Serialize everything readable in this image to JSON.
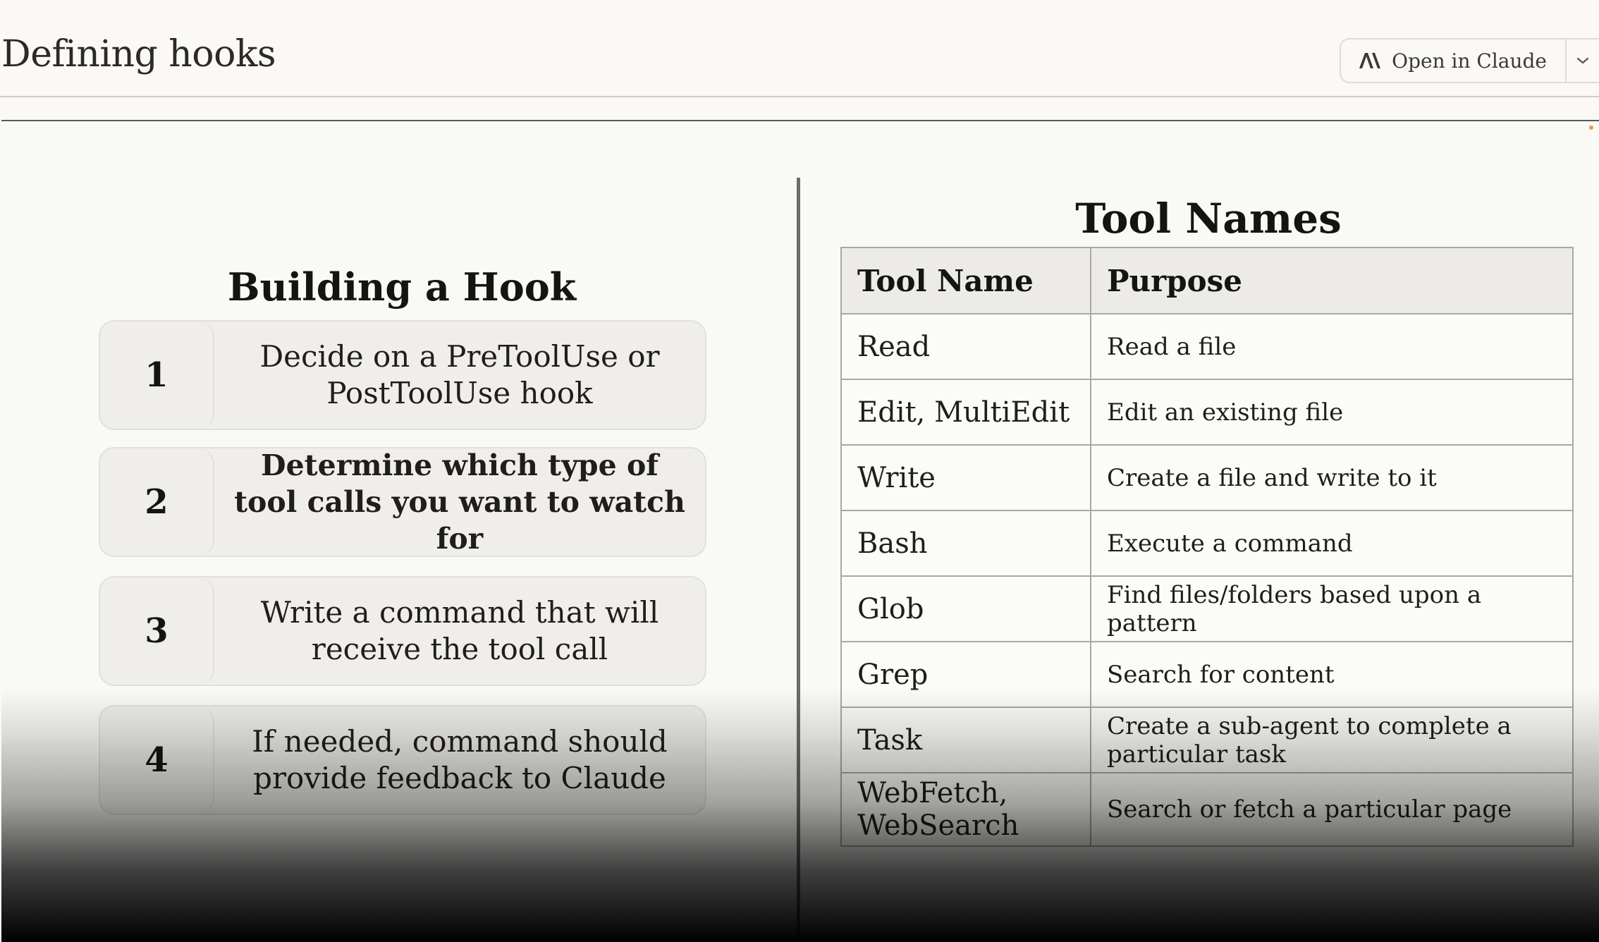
{
  "header": {
    "title": "Defining hooks",
    "open_button_label": "Open in Claude"
  },
  "slide": {
    "left": {
      "heading": "Building a Hook",
      "steps": [
        {
          "number": "1",
          "text": "Decide on a PreToolUse or PostToolUse hook",
          "emphasized": false
        },
        {
          "number": "2",
          "text": "Determine which type of tool calls you want to watch for",
          "emphasized": true
        },
        {
          "number": "3",
          "text": "Write a command that will receive the tool call",
          "emphasized": false
        },
        {
          "number": "4",
          "text": "If needed, command should provide feedback to Claude",
          "emphasized": false
        }
      ]
    },
    "right": {
      "heading": "Tool Names",
      "columns": [
        "Tool Name",
        "Purpose"
      ],
      "rows": [
        {
          "name": "Read",
          "purpose": "Read a file"
        },
        {
          "name": "Edit, MultiEdit",
          "purpose": "Edit an existing file"
        },
        {
          "name": "Write",
          "purpose": "Create a file and write to it"
        },
        {
          "name": "Bash",
          "purpose": "Execute a command"
        },
        {
          "name": "Glob",
          "purpose": "Find files/folders based upon a pattern"
        },
        {
          "name": "Grep",
          "purpose": "Search for content"
        },
        {
          "name": "Task",
          "purpose": "Create a sub-agent to complete a particular task"
        },
        {
          "name": "WebFetch, WebSearch",
          "purpose": "Search or fetch a particular page"
        }
      ]
    }
  },
  "icons": {
    "open_button_icon": "anthropic-logo-icon",
    "dropdown_icon": "chevron-down-icon"
  },
  "colors": {
    "page_background": "#faf9f5",
    "slide_background": "#f9faf6",
    "step_background": "#efeeeb",
    "table_header_background": "#ecebe7",
    "accent_dot": "#e0a040"
  }
}
